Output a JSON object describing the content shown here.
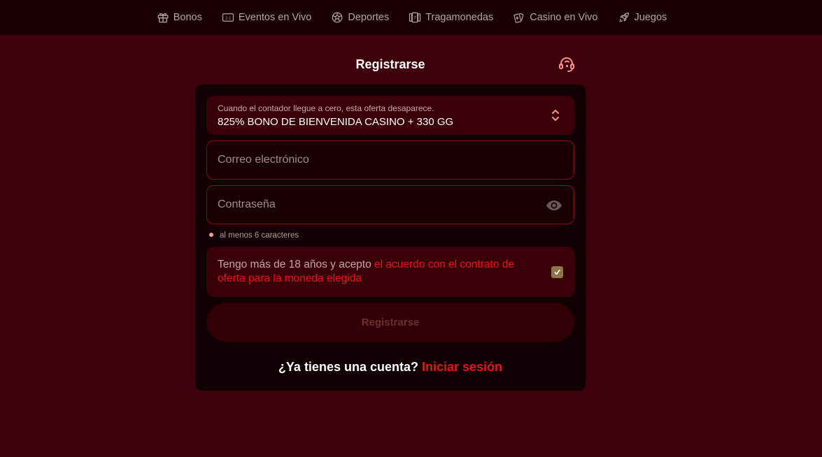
{
  "nav": {
    "items": [
      {
        "label": "Bonos",
        "icon": "gift-icon"
      },
      {
        "label": "Eventos en Vivo",
        "icon": "scoreboard-icon"
      },
      {
        "label": "Deportes",
        "icon": "soccer-ball-icon"
      },
      {
        "label": "Tragamonedas",
        "icon": "slot-machine-icon"
      },
      {
        "label": "Casino en Vivo",
        "icon": "playing-cards-icon"
      },
      {
        "label": "Juegos",
        "icon": "rocket-icon"
      }
    ]
  },
  "page": {
    "title": "Registrarse",
    "support_icon": "support-headset-icon"
  },
  "form": {
    "bonus": {
      "hint": "Cuando el contador llegue a cero, esta oferta desaparece.",
      "selected": "825% BONO DE BIENVENIDA CASINO + 330 GG",
      "icon": "chevron-up-down-icon"
    },
    "email": {
      "placeholder": "Correo electrónico",
      "value": ""
    },
    "password": {
      "placeholder": "Contraseña",
      "value": "",
      "icon": "eye-icon"
    },
    "password_hint": "al menos 6 caracteres",
    "terms": {
      "text": "Tengo más de 18 años y acepto ",
      "link": "el acuerdo con el contrato de oferta para la moneda elegida",
      "checked": true
    },
    "submit_label": "Registrarse",
    "login_question": "¿Ya tienes una cuenta?",
    "login_link": "Iniciar sesión"
  },
  "colors": {
    "background": "#3d000c",
    "topbar": "#180003",
    "card": "#110003",
    "accent_red": "#e8131c",
    "field_border": "#8a0d14",
    "checkbox": "#8d744a"
  }
}
